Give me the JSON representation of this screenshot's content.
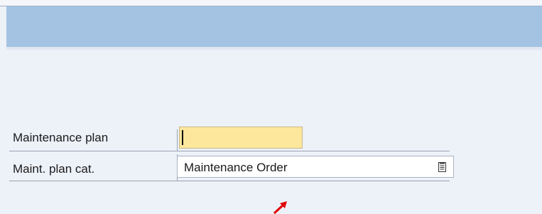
{
  "form": {
    "maintenance_plan": {
      "label": "Maintenance plan",
      "value": ""
    },
    "plan_category": {
      "label": "Maint. plan cat.",
      "value": "Maintenance Order"
    }
  },
  "icons": {
    "dropdown": "dropdown-list-icon",
    "pointer": "red-arrow-pointer-icon"
  },
  "colors": {
    "header_band": "#a4c3e3",
    "background": "#edf1f8",
    "required_field": "#fde79c",
    "pointer": "#e00000"
  }
}
